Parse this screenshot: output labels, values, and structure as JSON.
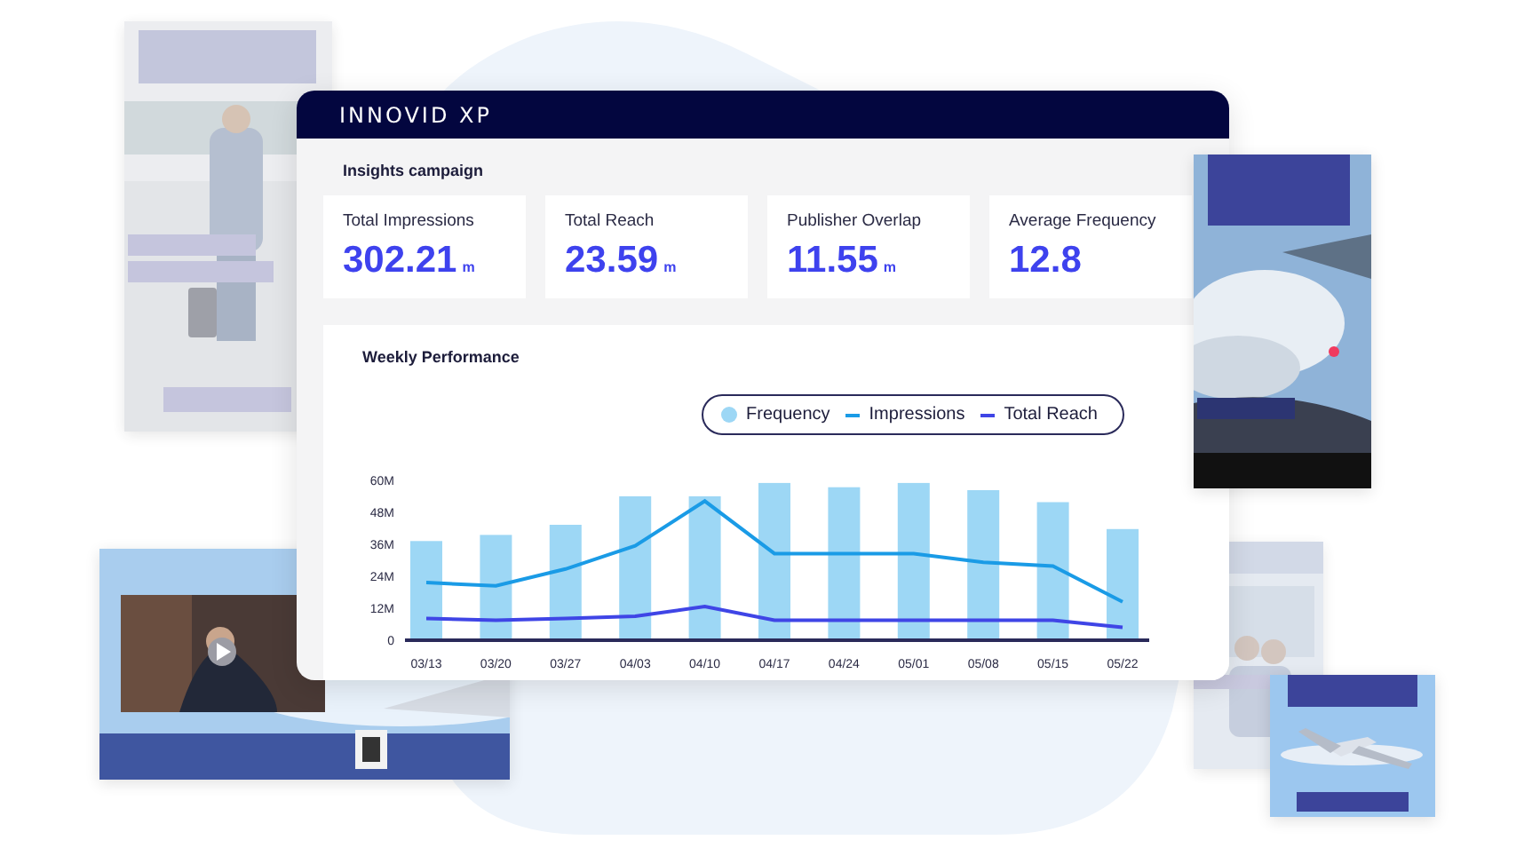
{
  "window": {
    "title": "INNOVID XP"
  },
  "section_title": "Insights campaign",
  "metrics": [
    {
      "label": "Total Impressions",
      "value": "302.21",
      "unit": "m"
    },
    {
      "label": "Total Reach",
      "value": "23.59",
      "unit": "m"
    },
    {
      "label": "Publisher Overlap",
      "value": "11.55",
      "unit": "m"
    },
    {
      "label": "Average Frequency",
      "value": "12.8"
    }
  ],
  "chart_panel": {
    "title": "Weekly Performance",
    "chart_data": {
      "type": "bar",
      "categories": [
        "03/13",
        "03/20",
        "03/27",
        "04/03",
        "04/10",
        "04/17",
        "04/24",
        "05/01",
        "05/08",
        "05/15",
        "05/22"
      ],
      "series": [
        {
          "name": "Frequency",
          "type": "bar",
          "color": "#9dd7f5",
          "values": [
            36.9,
            39.2,
            43.0,
            53.7,
            53.7,
            58.7,
            57.1,
            58.7,
            56.0,
            51.5,
            41.4
          ]
        },
        {
          "name": "Impressions",
          "type": "line",
          "color": "#1a9be6",
          "values": [
            21.3,
            20.1,
            26.4,
            35.1,
            51.9,
            32.2,
            32.2,
            32.2,
            28.9,
            27.5,
            14.1
          ]
        },
        {
          "name": "Total Reach",
          "type": "line",
          "color": "#3f45e6",
          "values": [
            7.8,
            7.2,
            7.8,
            8.7,
            12.3,
            7.2,
            7.2,
            7.2,
            7.2,
            7.2,
            4.5
          ]
        }
      ],
      "ylim": [
        0,
        60
      ],
      "yticks": [
        {
          "value": 0,
          "label": "0"
        },
        {
          "value": 12,
          "label": "12M"
        },
        {
          "value": 24,
          "label": "24M"
        },
        {
          "value": 36,
          "label": "36M"
        },
        {
          "value": 48,
          "label": "48M"
        },
        {
          "value": 60,
          "label": "60M"
        }
      ]
    }
  }
}
